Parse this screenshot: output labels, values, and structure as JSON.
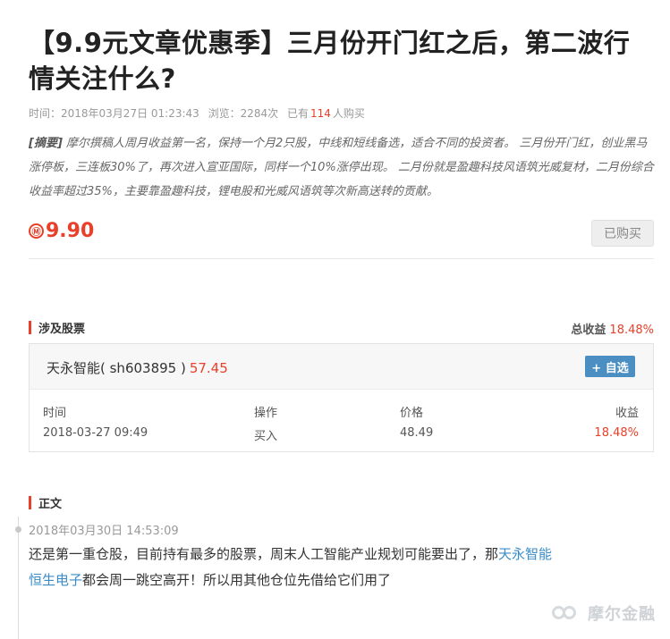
{
  "article": {
    "title": "【9.9元文章优惠季】三月份开门红之后，第二波行情关注什么?",
    "meta": {
      "time_label": "时间：2018年03月27日 01:23:43",
      "views_label": "浏览：2284次",
      "bought_prefix": "已有",
      "bought_count": "114",
      "bought_suffix": "人购买"
    },
    "summary_label": "[摘要]",
    "summary_text": " 摩尔撰稿人周月收益第一名，保持一个月2只股，中线和短线备选，适合不同的投资者。 三月份开门红，创业黑马涨停板，三连板30%了，再次进入宣亚国际，同样一个10%涨停出现。 二月份就是盈趣科技风语筑光威复材，二月份综合收益率超过35%，主要靠盈趣科技，锂电股和光威风语筑等次新高送转的贡献。",
    "price_icon": "Ⓜ",
    "price": "9.90",
    "bought_button": "已购买"
  },
  "stocks_section": {
    "heading": "涉及股票",
    "total_return_label": "总收益",
    "total_return_value": "18.48%",
    "stock": {
      "name": "天永智能( sh603895 )",
      "price": "57.45",
      "watch_button": "+ 自选"
    },
    "columns": [
      "时间",
      "操作",
      "价格",
      "收益"
    ],
    "rows": [
      [
        "2018-03-27 09:49",
        "买入",
        "48.49",
        "18.48%"
      ]
    ]
  },
  "body_section": {
    "heading": "正文",
    "post_time": "2018年03月30日 14:53:09",
    "text_1": "还是第一重仓股，目前持有最多的股票，周末人工智能产业规划可能要出了，那",
    "link_1": "天永智能",
    "link_2": "恒生电子",
    "text_2": "都会周一跳空高开！所以用其他仓位先借给它们用了"
  },
  "watermark": "摩尔金融",
  "colors": {
    "accent_red": "#e8402a",
    "button_blue": "#4a8ec2",
    "link_blue": "#3a8cc8"
  }
}
